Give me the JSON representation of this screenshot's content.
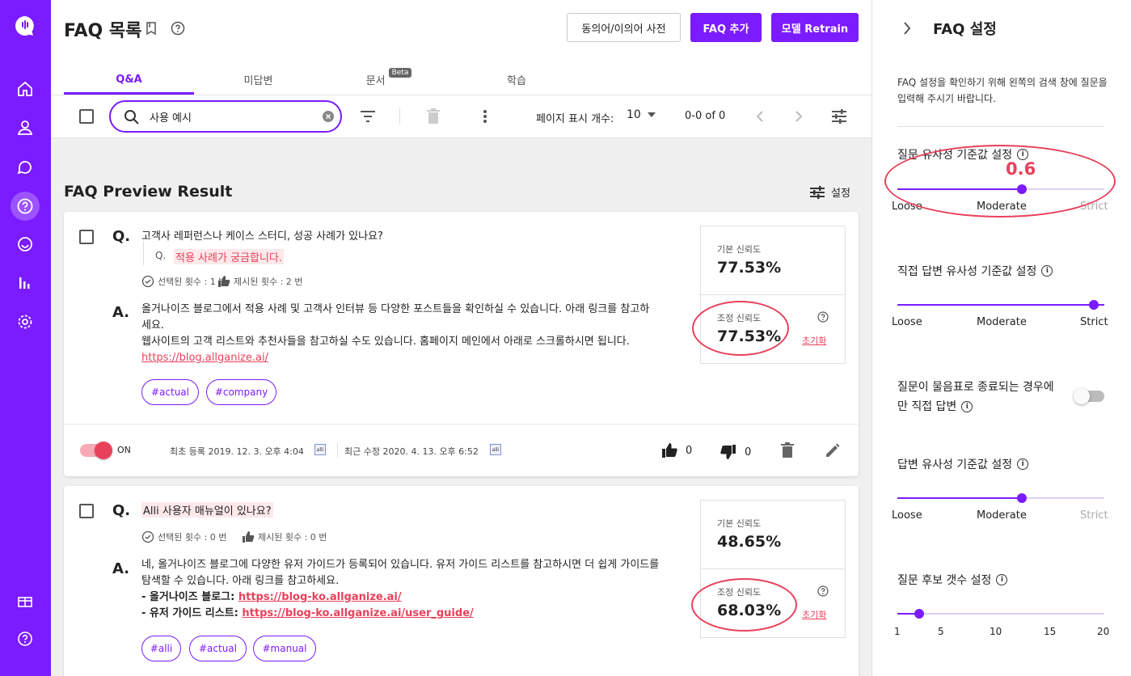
{
  "nav": {
    "icons": [
      "logo-icon",
      "home-icon",
      "user-icon",
      "chat-icon",
      "faq-icon",
      "bot-icon",
      "stats-icon",
      "settings-icon",
      "gift-icon",
      "help-icon"
    ]
  },
  "header": {
    "title": "FAQ 목록",
    "synonym_button": "동의어/이의어 사전",
    "add_faq_button": "FAQ 추가",
    "retrain_button": "모델 Retrain"
  },
  "tabs": [
    {
      "label": "Q&A",
      "active": true
    },
    {
      "label": "미답변",
      "active": false
    },
    {
      "label": "문서",
      "badge": "Beta",
      "active": false
    },
    {
      "label": "학습",
      "active": false
    }
  ],
  "toolbar": {
    "search_value": "사용 예시",
    "page_size_label": "페이지 표시 개수:",
    "page_size": "10",
    "page_range": "0-0 of 0"
  },
  "preview": {
    "title": "FAQ Preview Result",
    "settings_label": "설정"
  },
  "cards": [
    {
      "question": "고객사 레퍼런스나 케이스 스터디, 성공 사례가 있나요?",
      "similar_question_prefix": "Q.",
      "similar_question": "적용 사례가 궁금합니다.",
      "selected_count": "선택된 횟수 : 1 번",
      "shown_count": "제시된 횟수 : 2 번",
      "answer_line1": "올거나이즈 블로그에서 적용 사례 및 고객사 인터뷰 등 다양한 포스트들을 확인하실 수 있습니다. 아래 링크를 참고하세요.",
      "answer_line2": "웹사이트의 고객 리스트와 추천사들을 참고하실 수도 있습니다. 홈페이지 메인에서 아래로 스크롤하시면 됩니다.",
      "answer_link": "https://blog.allganize.ai/",
      "tags": [
        "#actual",
        "#company"
      ],
      "base_label": "기본 신뢰도",
      "base_value": "77.53%",
      "adjusted_label": "조정 신뢰도",
      "adjusted_value": "77.53%",
      "reset_label": "초기화",
      "toggle_label": "ON",
      "created": "최초 등록 2019. 12. 3. 오후 4:04",
      "modified": "최근 수정 2020. 4. 13. 오후 6:52",
      "likes": "0",
      "dislikes": "0"
    },
    {
      "question": "Alli 사용자 매뉴얼이 있나요?",
      "selected_count": "선택된 횟수 : 0 번",
      "shown_count": "제시된 횟수 : 0 번",
      "answer_line1": "네, 올거나이즈 블로그에 다양한 유저 가이드가 등록되어 있습니다. 유저 가이드 리스트를 참고하시면 더 쉽게 가이드를",
      "answer_line2": "탐색할 수 있습니다. 아래 링크를 참고하세요.",
      "blog_label": "- 올거나이즈 블로그: ",
      "blog_link": "https://blog-ko.allganize.ai/",
      "guide_label": "- 유저 가이드 리스트: ",
      "guide_link": "https://blog-ko.allganize.ai/user_guide/",
      "tags": [
        "#alli",
        "#actual",
        "#manual"
      ],
      "base_label": "기본 신뢰도",
      "base_value": "48.65%",
      "adjusted_label": "조정 신뢰도",
      "adjusted_value": "68.03%",
      "reset_label": "초기화"
    }
  ],
  "settings_panel": {
    "title": "FAQ 설정",
    "description": "FAQ 설정을 확인하기 위해 왼쪽의 검색 창에 질문을 입력해 주시기 바랍니다.",
    "question_similarity": {
      "label": "질문 유사성 기준값 설정",
      "value_annotation": "0.6",
      "level": 0.6,
      "loose": "Loose",
      "moderate": "Moderate",
      "strict": "Strict"
    },
    "direct_answer_similarity": {
      "label": "직접 답변 유사성 기준값 설정",
      "level": 1.0,
      "loose": "Loose",
      "moderate": "Moderate",
      "strict": "Strict"
    },
    "question_mark_toggle": {
      "label_line1": "질문이 물음표로 종료되는 경우에",
      "label_line2": "만 직접 답변",
      "on": false
    },
    "answer_similarity": {
      "label": "답변 유사성 기준값 설정",
      "level": 0.6,
      "loose": "Loose",
      "moderate": "Moderate",
      "strict": "Strict"
    },
    "candidate_count": {
      "label": "질문 후보 갯수 설정",
      "value": 3,
      "ticks": [
        "1",
        "5",
        "10",
        "15",
        "20"
      ]
    }
  },
  "colors": {
    "brand": "#7b1bff",
    "accent_red": "#e8415b",
    "highlight": "#fde8ea"
  }
}
